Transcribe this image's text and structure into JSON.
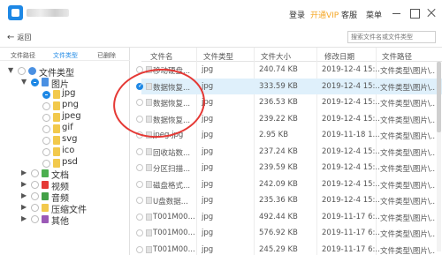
{
  "titlebar": {
    "login": "登录",
    "vip": "开通VIP",
    "service": "客服",
    "menu": "菜单"
  },
  "nav": {
    "back": "返回",
    "search_placeholder": "搜索文件名或文件类型"
  },
  "left_tabs": [
    "文件路径",
    "文件类型",
    "已删除"
  ],
  "tree": {
    "root": "文件类型",
    "images": "图片",
    "subtypes": [
      "jpg",
      "png",
      "jpeg",
      "gif",
      "svg",
      "ico",
      "psd"
    ],
    "others": [
      "文档",
      "视频",
      "音频",
      "压缩文件",
      "其他"
    ]
  },
  "columns": [
    "文件名",
    "文件类型",
    "文件大小",
    "修改日期",
    "文件路径"
  ],
  "rows": [
    {
      "name": "移动硬盘...",
      "type": "jpg",
      "size": "240.74 KB",
      "date": "2019-12-4 15:...",
      "path": "文件类型\\图片\\..."
    },
    {
      "name": "数据恢复...",
      "type": "jpg",
      "size": "333.59 KB",
      "date": "2019-12-4 15:...",
      "path": "文件类型\\图片\\..."
    },
    {
      "name": "数据恢复...",
      "type": "jpg",
      "size": "236.53 KB",
      "date": "2019-12-4 15:...",
      "path": "文件类型\\图片\\..."
    },
    {
      "name": "数据恢复...",
      "type": "jpg",
      "size": "239.22 KB",
      "date": "2019-12-4 15:...",
      "path": "文件类型\\图片\\..."
    },
    {
      "name": "jpeg.jpg",
      "type": "jpg",
      "size": "2.95 KB",
      "date": "2019-11-18 1...",
      "path": "文件类型\\图片\\..."
    },
    {
      "name": "回收站数...",
      "type": "jpg",
      "size": "237.24 KB",
      "date": "2019-12-4 15:...",
      "path": "文件类型\\图片\\..."
    },
    {
      "name": "分区扫描...",
      "type": "jpg",
      "size": "239.59 KB",
      "date": "2019-12-4 15:...",
      "path": "文件类型\\图片\\..."
    },
    {
      "name": "磁盘格式...",
      "type": "jpg",
      "size": "242.09 KB",
      "date": "2019-12-4 15:...",
      "path": "文件类型\\图片\\..."
    },
    {
      "name": "U盘数据...",
      "type": "jpg",
      "size": "235.36 KB",
      "date": "2019-12-4 15:...",
      "path": "文件类型\\图片\\..."
    },
    {
      "name": "T001M00...",
      "type": "jpg",
      "size": "492.44 KB",
      "date": "2019-11-17 6:...",
      "path": "文件类型\\图片\\..."
    },
    {
      "name": "T001M00...",
      "type": "jpg",
      "size": "576.92 KB",
      "date": "2019-11-17 6:...",
      "path": "文件类型\\图片\\..."
    },
    {
      "name": "T001M00...",
      "type": "jpg",
      "size": "245.29 KB",
      "date": "2019-11-17 6:...",
      "path": "文件类型\\图片\\..."
    }
  ],
  "selected_row": 1,
  "colors": {
    "accent": "#1e88e5",
    "vip": "#f5a623",
    "annotation": "#e53935",
    "selection": "#dff0fb"
  }
}
